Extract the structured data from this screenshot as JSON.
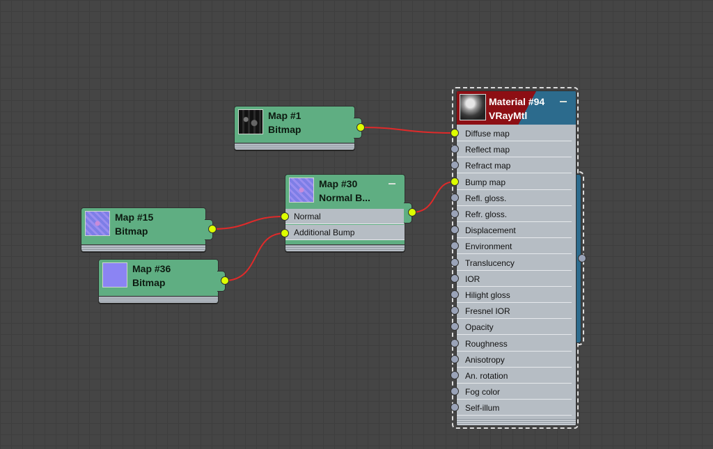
{
  "nodes": {
    "map1": {
      "title": "Map #1",
      "type": "Bitmap"
    },
    "map15": {
      "title": "Map #15",
      "type": "Bitmap"
    },
    "map36": {
      "title": "Map #36",
      "type": "Bitmap"
    },
    "map30": {
      "title": "Map #30",
      "type": "Normal B...",
      "slots": [
        "Normal",
        "Additional Bump"
      ]
    },
    "material": {
      "title": "Material #94",
      "type": "VRayMtl",
      "slots": [
        "Diffuse map",
        "Reflect map",
        "Refract map",
        "Bump map",
        "Refl. gloss.",
        "Refr. gloss.",
        "Displacement",
        "Environment",
        "Translucency",
        "IOR",
        "Hilight gloss",
        "Fresnel IOR",
        "Opacity",
        "Roughness",
        "Anisotropy",
        "An. rotation",
        "Fog color",
        "Self-illum"
      ],
      "connected_slots": [
        "Diffuse map",
        "Bump map"
      ]
    }
  },
  "connections": [
    {
      "from": "Map #1",
      "to": "Material #94: Diffuse map"
    },
    {
      "from": "Map #15",
      "to": "Map #30: Normal"
    },
    {
      "from": "Map #36",
      "to": "Map #30: Additional Bump"
    },
    {
      "from": "Map #30",
      "to": "Material #94: Bump map"
    }
  ],
  "colors": {
    "canvas": "#454545",
    "map_node": "#5fae82",
    "slot_bg": "#b6bdc4",
    "port_connected": "#ddff00",
    "port_empty": "#9aa3b8",
    "wire": "#e02a2a",
    "material_header_red": "#8d0f14",
    "material_header_blue": "#2c6b8d"
  },
  "icons": {
    "minimize": "minus-icon",
    "map1_preview": "dark-texture-thumbnail",
    "map15_preview": "normal-map-thumbnail",
    "map36_preview": "flat-normal-thumbnail",
    "map30_preview": "normal-map-thumbnail",
    "material_preview": "sphere-thumbnail"
  }
}
